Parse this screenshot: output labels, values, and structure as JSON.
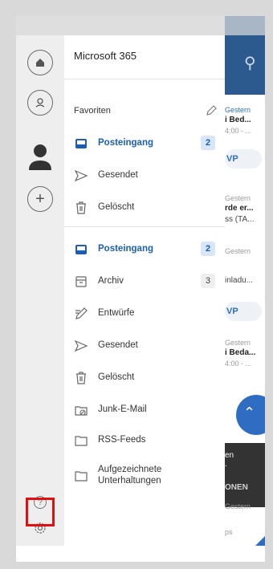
{
  "account": {
    "name": "Microsoft 365"
  },
  "favorites": {
    "section_label": "Favoriten",
    "items": [
      {
        "label": "Posteingang",
        "count": "2",
        "active": true
      },
      {
        "label": "Gesendet"
      },
      {
        "label": "Gelöscht"
      }
    ]
  },
  "folders": [
    {
      "label": "Posteingang",
      "count": "2",
      "active": true
    },
    {
      "label": "Archiv",
      "count": "3"
    },
    {
      "label": "Entwürfe"
    },
    {
      "label": "Gesendet"
    },
    {
      "label": "Gelöscht"
    },
    {
      "label": "Junk-E-Mail"
    },
    {
      "label": "RSS-Feeds"
    },
    {
      "label_line1": "Aufgezeichnete",
      "label_line2": "Unterhaltungen"
    }
  ],
  "background": {
    "items": [
      {
        "date": "Gestern",
        "subject": "i Bed...",
        "time": "4:00 - ..."
      },
      {
        "pill": "VP"
      },
      {
        "date": "Gestern",
        "subject": "rde er...",
        "preview": "ss (TA..."
      },
      {
        "date": "Gestern",
        "preview": "inladu..."
      },
      {
        "pill": "VP"
      },
      {
        "date": "Gestern",
        "subject": "i Beda...",
        "time": "4:00 - ..."
      }
    ],
    "toast": {
      "line1": "en",
      "line2": ".",
      "action": "ONEN"
    },
    "footer_date": "Gestern",
    "footer_tab": "ps"
  },
  "colors": {
    "accent": "#1a5fb4",
    "highlight": "#e01010",
    "header": "#2c5a8e"
  },
  "icons": {
    "rail": [
      "home-icon",
      "account-icon",
      "person-icon",
      "add-icon",
      "help-icon",
      "settings-icon"
    ],
    "folders": [
      "inbox-icon",
      "send-icon",
      "trash-icon",
      "archive-icon",
      "drafts-icon",
      "junk-icon",
      "folder-icon"
    ]
  }
}
